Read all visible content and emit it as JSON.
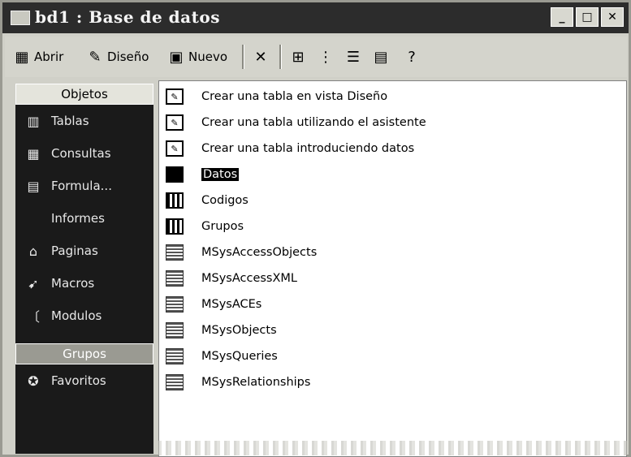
{
  "window": {
    "title": "bd1 : Base de datos",
    "minimize_glyph": "_",
    "maximize_glyph": "□",
    "close_glyph": "✕"
  },
  "toolbar": {
    "open_label": "Abrir",
    "design_label": "Diseño",
    "new_label": "Nuevo",
    "delete_glyph": "✕"
  },
  "sidebar": {
    "objects_header": "Objetos",
    "items": [
      {
        "label": "Tablas",
        "icon": "table-icon"
      },
      {
        "label": "Consultas",
        "icon": "query-icon"
      },
      {
        "label": "Formula...",
        "icon": "form-icon"
      },
      {
        "label": "Informes",
        "icon": "report-icon"
      },
      {
        "label": "Paginas",
        "icon": "page-icon"
      },
      {
        "label": "Macros",
        "icon": "macro-icon"
      },
      {
        "label": "Modulos",
        "icon": "module-icon"
      }
    ],
    "groups_header": "Grupos",
    "favorites_label": "Favoritos"
  },
  "list": [
    {
      "label": "Crear una tabla en vista Diseño",
      "kind": "create"
    },
    {
      "label": "Crear una tabla utilizando el asistente",
      "kind": "create"
    },
    {
      "label": "Crear una tabla introduciendo datos",
      "kind": "create"
    },
    {
      "label": "Datos",
      "kind": "selected"
    },
    {
      "label": "Codigos",
      "kind": "table"
    },
    {
      "label": "Grupos",
      "kind": "table"
    },
    {
      "label": "MSysAccessObjects",
      "kind": "sys"
    },
    {
      "label": "MSysAccessXML",
      "kind": "sys"
    },
    {
      "label": "MSysACEs",
      "kind": "sys"
    },
    {
      "label": "MSysObjects",
      "kind": "sys"
    },
    {
      "label": "MSysQueries",
      "kind": "sys"
    },
    {
      "label": "MSysRelationships",
      "kind": "sys"
    }
  ],
  "colors": {
    "titlebar": "#2c2c2c",
    "sidebar": "#1a1a1a",
    "selection": "#000000"
  }
}
